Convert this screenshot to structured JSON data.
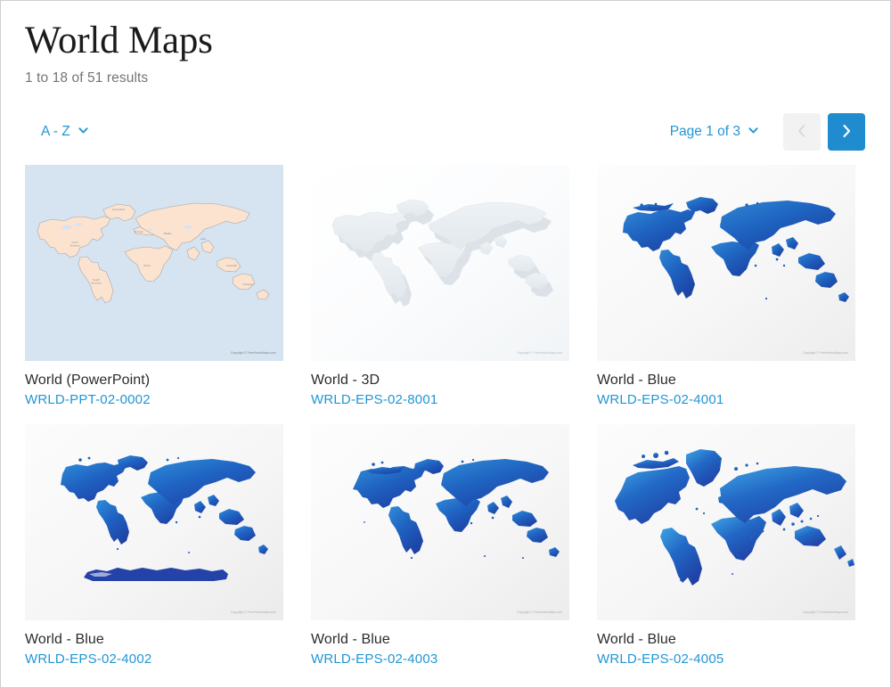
{
  "header": {
    "title": "World Maps",
    "result_count": "1 to 18 of 51 results"
  },
  "controls": {
    "sort_label": "A - Z",
    "sort_icon": "chevron-down-icon",
    "page_label": "Page 1 of 3",
    "page_icon": "chevron-down-icon",
    "prev_icon": "chevron-left-icon",
    "next_icon": "chevron-right-icon",
    "prev_enabled": false,
    "next_enabled": true
  },
  "colors": {
    "link_blue": "#2196d6",
    "button_blue": "#1f8ccf",
    "button_disabled": "#f2f2f2",
    "title_dark": "#1b1b1b",
    "muted_gray": "#757575",
    "ppt_ocean": "#d6e3f0",
    "ppt_land": "#fce3d0",
    "map_blue_light": "#2f7fd0",
    "map_blue_dark": "#20439b"
  },
  "copyright_text": "Copyright © FreeVectorMaps.com",
  "cards": [
    {
      "title": "World (PowerPoint)",
      "code": "WRLD-PPT-02-0002",
      "style": "powerpoint"
    },
    {
      "title": "World - 3D",
      "code": "WRLD-EPS-02-8001",
      "style": "threed"
    },
    {
      "title": "World - Blue",
      "code": "WRLD-EPS-02-4001",
      "style": "blue-plain"
    },
    {
      "title": "World - Blue",
      "code": "WRLD-EPS-02-4002",
      "style": "blue-antarctica"
    },
    {
      "title": "World - Blue",
      "code": "WRLD-EPS-02-4003",
      "style": "blue-plain-2"
    },
    {
      "title": "World - Blue",
      "code": "WRLD-EPS-02-4005",
      "style": "blue-zoom"
    }
  ]
}
